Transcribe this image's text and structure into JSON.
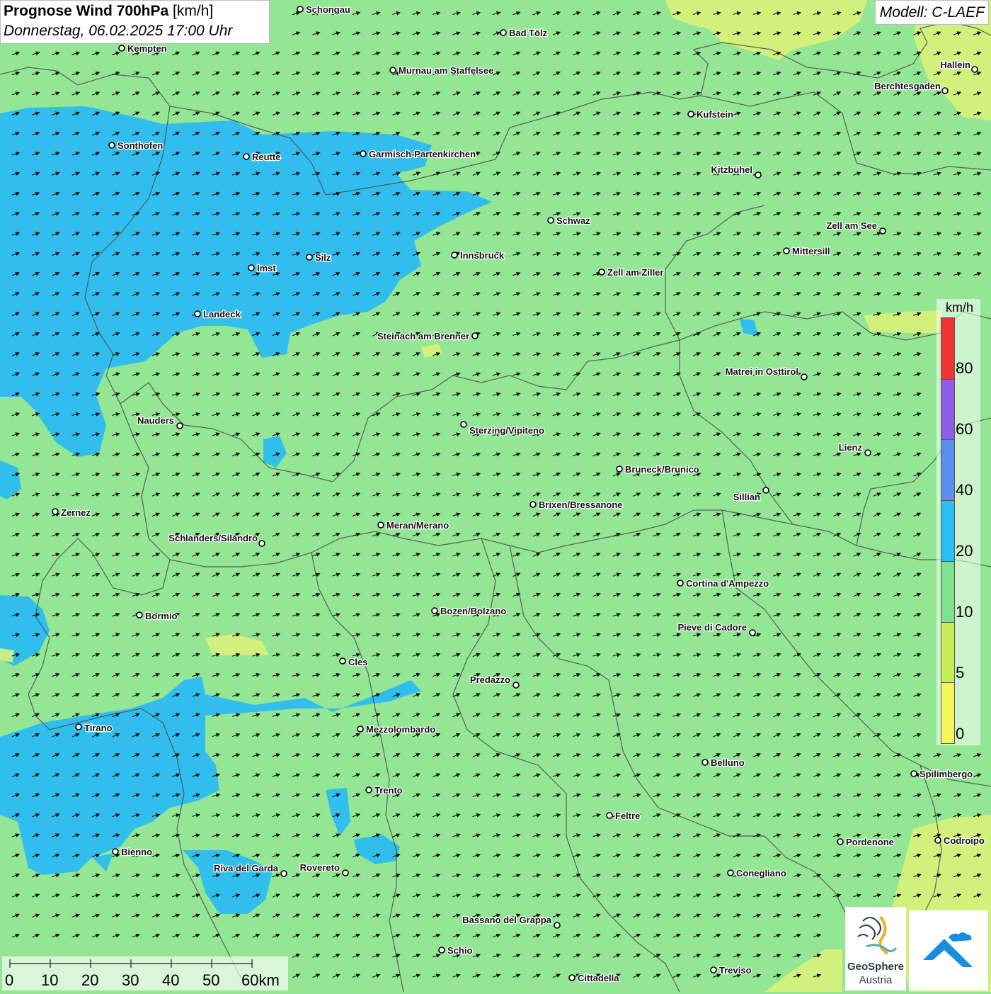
{
  "title": {
    "main": "Prognose Wind 700hPa",
    "unit": "[km/h]",
    "datetime": "Donnerstag, 06.02.2025 17:00 Uhr"
  },
  "model": "Modell: C-LAEF",
  "legend": {
    "unit": "km/h",
    "labels": [
      "80",
      "60",
      "40",
      "20",
      "10",
      "5",
      "0"
    ],
    "colors": [
      "#f03535",
      "#8f5ce8",
      "#5a8ff0",
      "#29bff5",
      "#7fe08f",
      "#c8ee55",
      "#f6f65c"
    ]
  },
  "scale": {
    "labels": [
      "0",
      "10",
      "20",
      "30",
      "40",
      "50",
      "60km"
    ]
  },
  "colors": {
    "base_green": "#93e693",
    "blue_zone": "#2bbcf2",
    "yellow_zone": "#d8f27a",
    "border": "#4a4a4a",
    "arrow": "#111111"
  },
  "cities": [
    {
      "name": "Schongau"
    },
    {
      "name": "Bad Tölz"
    },
    {
      "name": "Kempten"
    },
    {
      "name": "Murnau am Staffelsee"
    },
    {
      "name": "Hallein"
    },
    {
      "name": "Berchtesgaden"
    },
    {
      "name": "Kufstein"
    },
    {
      "name": "Sonthofen"
    },
    {
      "name": "Reutte"
    },
    {
      "name": "Garmisch-Partenkirchen"
    },
    {
      "name": "Kitzbühel"
    },
    {
      "name": "Schwaz"
    },
    {
      "name": "Zell am See"
    },
    {
      "name": "Innsbruck"
    },
    {
      "name": "Mittersill"
    },
    {
      "name": "Silz"
    },
    {
      "name": "Imst"
    },
    {
      "name": "Zell am Ziller"
    },
    {
      "name": "Landeck"
    },
    {
      "name": "Steinach am Brenner"
    },
    {
      "name": "Matrei in Osttirol"
    },
    {
      "name": "Nauders"
    },
    {
      "name": "Sterzing/Vipiteno"
    },
    {
      "name": "Lienz"
    },
    {
      "name": "Bruneck/Brunico"
    },
    {
      "name": "Sillian"
    },
    {
      "name": "Zernez"
    },
    {
      "name": "Brixen/Bressanone"
    },
    {
      "name": "Meran/Merano"
    },
    {
      "name": "Schlanders/Silandro"
    },
    {
      "name": "Cortina d'Ampezzo"
    },
    {
      "name": "Bozen/Bolzano"
    },
    {
      "name": "Bormio"
    },
    {
      "name": "Pieve di Cadore"
    },
    {
      "name": "Cles"
    },
    {
      "name": "Predazzo"
    },
    {
      "name": "Tirano"
    },
    {
      "name": "Mezzolombardo"
    },
    {
      "name": "Belluno"
    },
    {
      "name": "Spilimbergo"
    },
    {
      "name": "Trento"
    },
    {
      "name": "Feltre"
    },
    {
      "name": "Bienno"
    },
    {
      "name": "Pordenone"
    },
    {
      "name": "Codroipo"
    },
    {
      "name": "Riva del Garda"
    },
    {
      "name": "Rovereto"
    },
    {
      "name": "Conegliano"
    },
    {
      "name": "Bassano del Grappa"
    },
    {
      "name": "Schio"
    },
    {
      "name": "Treviso"
    },
    {
      "name": "Cittadella"
    }
  ],
  "logo": {
    "name": "GeoSphere",
    "sub": "Austria"
  }
}
